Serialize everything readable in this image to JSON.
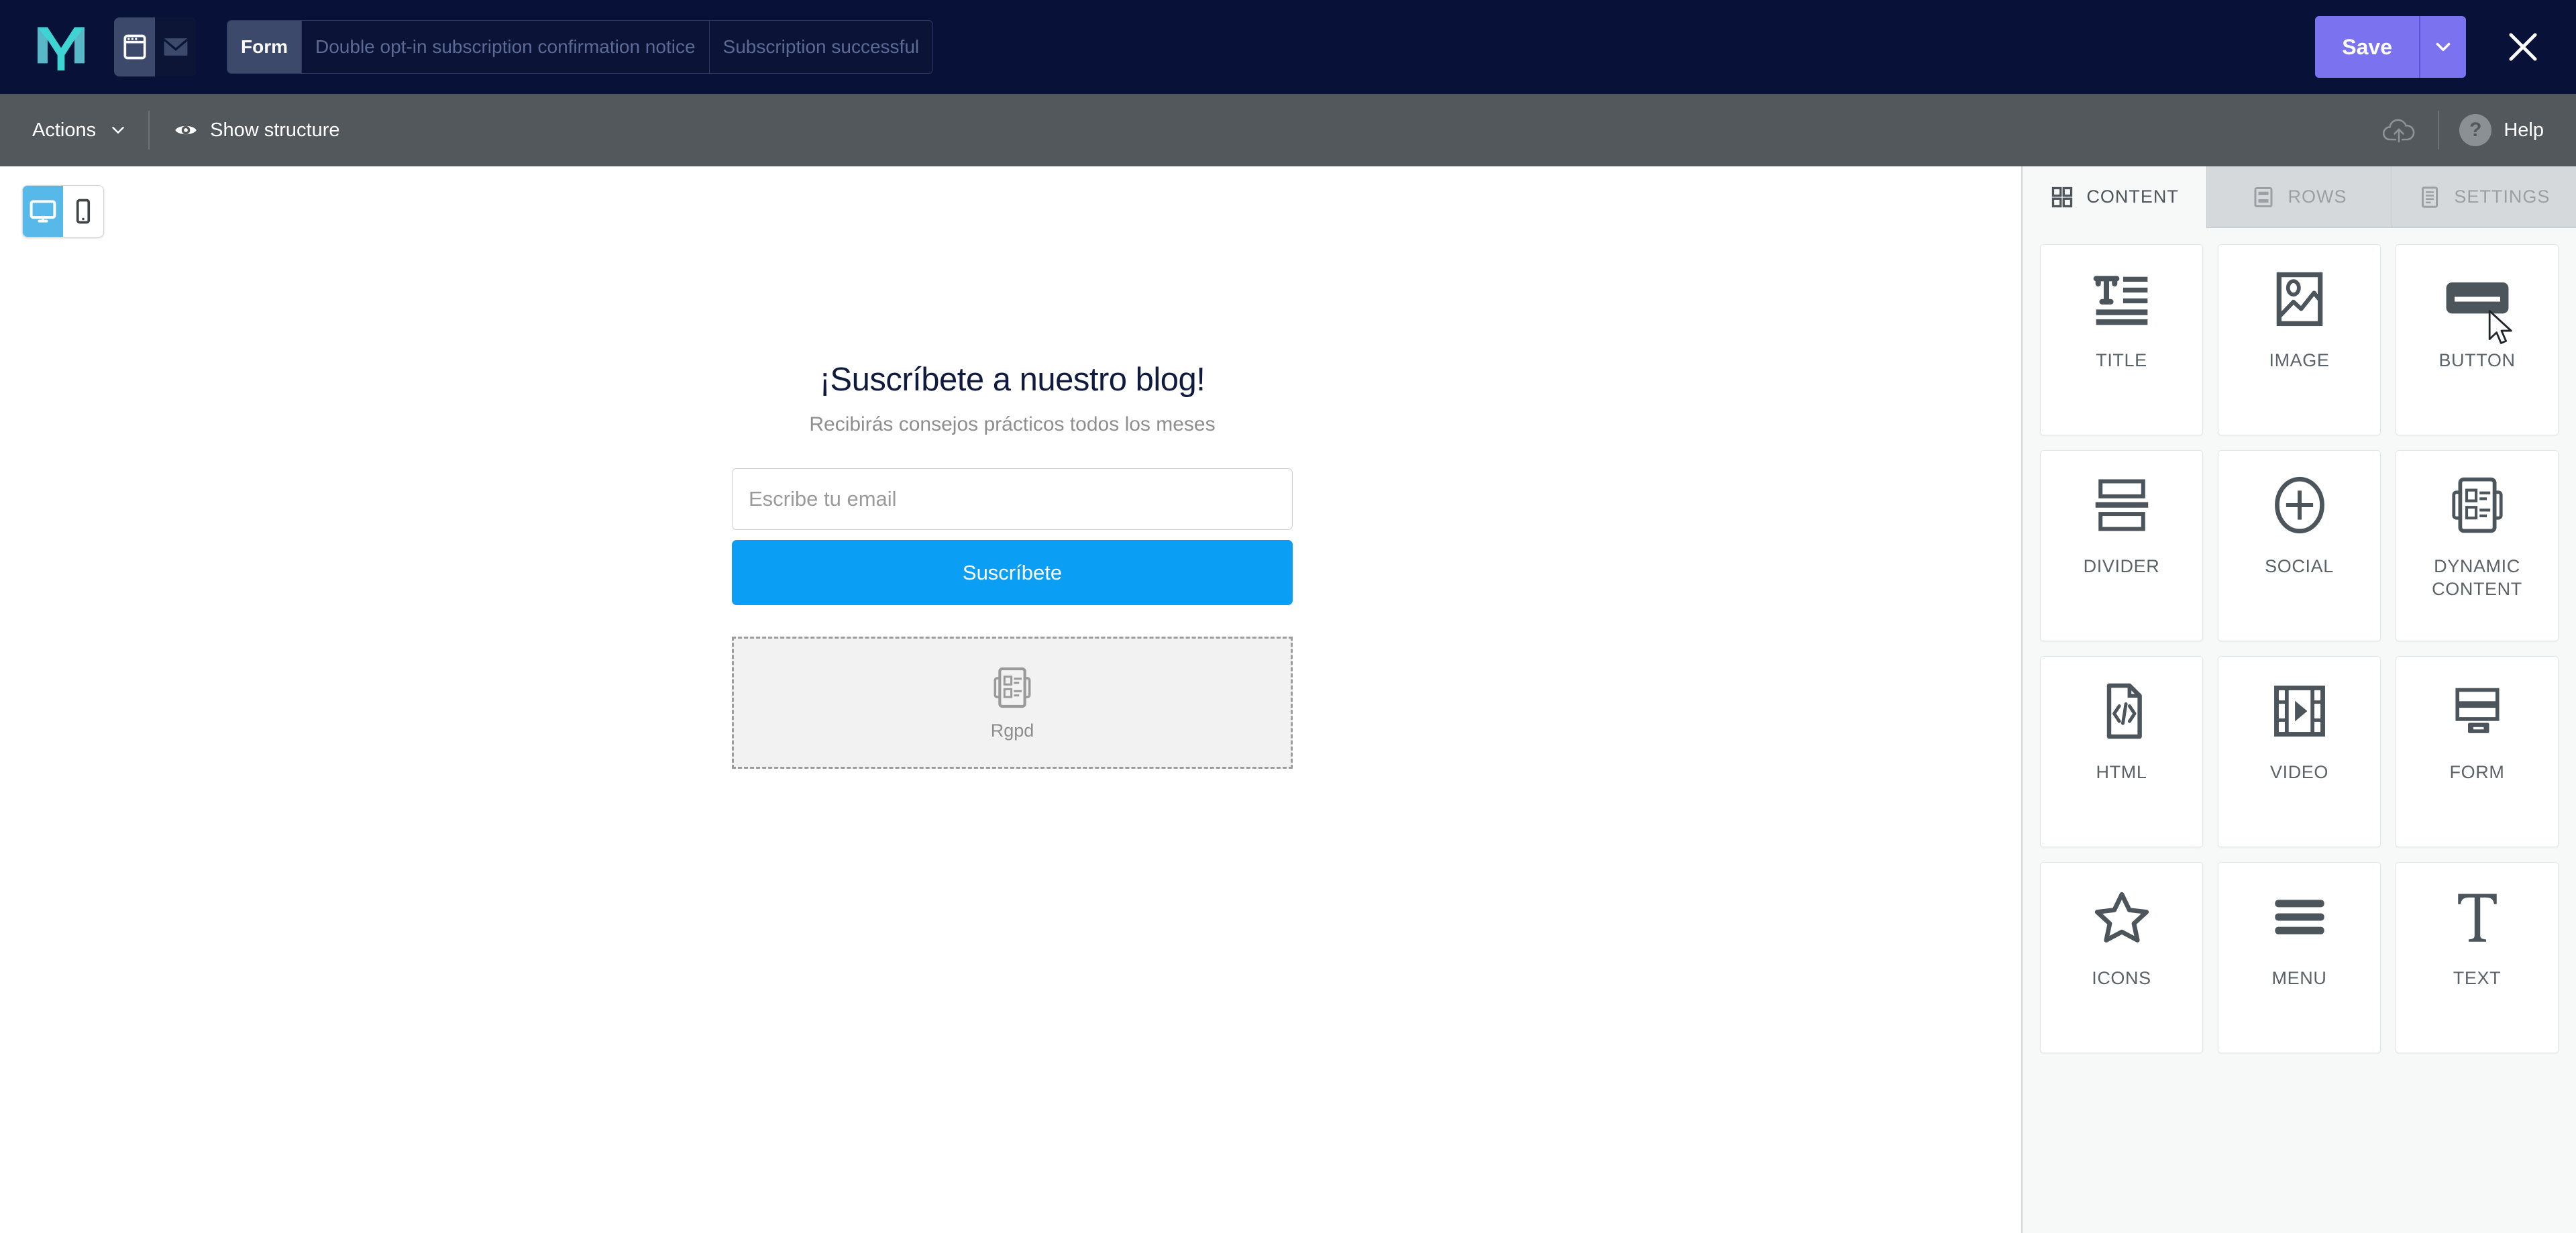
{
  "header": {
    "logo_name": "mailify-logo",
    "campaign_type_icons": [
      "browser-window-icon",
      "envelope-icon"
    ],
    "breadcrumbs": [
      {
        "label": "Form",
        "active": true
      },
      {
        "label": "Double opt-in subscription confirmation notice",
        "active": false
      },
      {
        "label": "Subscription successful",
        "active": false
      }
    ],
    "save_label": "Save",
    "save_color": "#7b72f0",
    "close_label": "Close",
    "background_color": "#081138"
  },
  "toolbar": {
    "actions_label": "Actions",
    "show_structure_label": "Show structure",
    "upload_label": "Upload",
    "help_label": "Help",
    "help_glyph": "?",
    "background_color": "#53585c"
  },
  "canvas": {
    "device_views": [
      {
        "name": "desktop",
        "active": true
      },
      {
        "name": "mobile",
        "active": false
      }
    ],
    "active_device_color": "#56b9e9",
    "email": {
      "title": "¡Suscríbete a nuestro blog!",
      "title_color": "#101a3e",
      "subtitle": "Recibirás consejos prácticos todos los meses",
      "subtitle_color": "#8e8e8e",
      "email_placeholder": "Escribe tu email",
      "submit_label": "Suscríbete",
      "submit_color": "#0b9ef5",
      "rgpd_block_label": "Rgpd"
    }
  },
  "panel": {
    "tabs": [
      {
        "label": "CONTENT",
        "icon": "grid-icon",
        "active": true
      },
      {
        "label": "ROWS",
        "icon": "rows-icon",
        "active": false
      },
      {
        "label": "SETTINGS",
        "icon": "document-lines-icon",
        "active": false
      }
    ],
    "tiles": [
      {
        "label": "TITLE",
        "icon": "title-icon"
      },
      {
        "label": "IMAGE",
        "icon": "image-icon"
      },
      {
        "label": "BUTTON",
        "icon": "button-icon"
      },
      {
        "label": "DIVIDER",
        "icon": "divider-icon"
      },
      {
        "label": "SOCIAL",
        "icon": "social-plus-circle-icon"
      },
      {
        "label": "DYNAMIC CONTENT",
        "icon": "dynamic-content-icon"
      },
      {
        "label": "HTML",
        "icon": "html-code-file-icon"
      },
      {
        "label": "VIDEO",
        "icon": "video-filmstrip-icon"
      },
      {
        "label": "FORM",
        "icon": "form-fields-icon"
      },
      {
        "label": "ICONS",
        "icon": "star-icon"
      },
      {
        "label": "MENU",
        "icon": "hamburger-menu-icon"
      },
      {
        "label": "TEXT",
        "icon": "serif-t-icon"
      }
    ]
  }
}
